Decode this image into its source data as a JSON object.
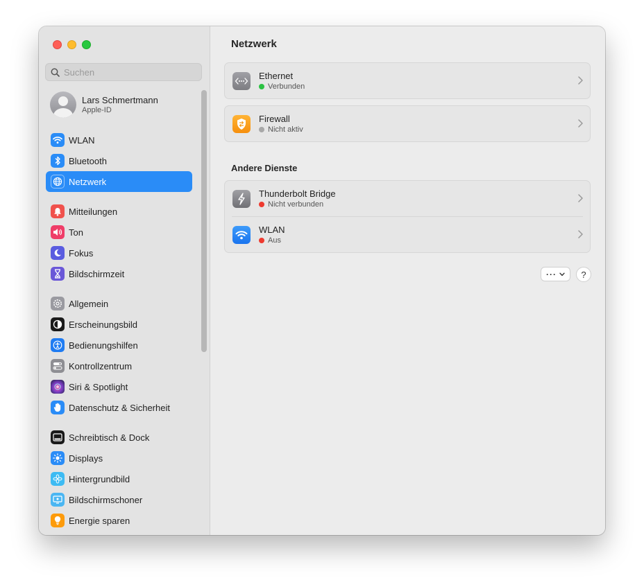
{
  "window": {
    "traffic_lights": [
      "close",
      "minimize",
      "zoom"
    ]
  },
  "sidebar": {
    "search": {
      "placeholder": "Suchen"
    },
    "profile": {
      "name": "Lars Schmertmann",
      "subtitle": "Apple-ID"
    },
    "items": [
      {
        "label": "WLAN",
        "icon": "wifi-icon",
        "color": "#2a8cf7",
        "active": false
      },
      {
        "label": "Bluetooth",
        "icon": "bluetooth-icon",
        "color": "#2a8cf7",
        "active": false
      },
      {
        "label": "Netzwerk",
        "icon": "globe-icon",
        "color": "#2a8cf7",
        "active": true
      },
      {
        "label": "Mitteilungen",
        "icon": "bell-icon",
        "color": "#f0514c",
        "active": false
      },
      {
        "label": "Ton",
        "icon": "speaker-icon",
        "color": "#ef3d68",
        "active": false
      },
      {
        "label": "Fokus",
        "icon": "moon-icon",
        "color": "#5a5ce0",
        "active": false
      },
      {
        "label": "Bildschirmzeit",
        "icon": "hourglass-icon",
        "color": "#6a57d8",
        "active": false
      },
      {
        "label": "Allgemein",
        "icon": "gear-icon",
        "color": "#9a9aa0",
        "active": false
      },
      {
        "label": "Erscheinungsbild",
        "icon": "appearance-icon",
        "color": "#1a1a1a",
        "active": false
      },
      {
        "label": "Bedienungshilfen",
        "icon": "accessibility-icon",
        "color": "#1f7cf2",
        "active": false
      },
      {
        "label": "Kontrollzentrum",
        "icon": "switches-icon",
        "color": "#8e8e93",
        "active": false
      },
      {
        "label": "Siri & Spotlight",
        "icon": "siri-icon",
        "color": "#7b3fc6",
        "active": false
      },
      {
        "label": "Datenschutz & Sicherheit",
        "icon": "hand-icon",
        "color": "#2a8cf7",
        "active": false
      },
      {
        "label": "Schreibtisch & Dock",
        "icon": "dock-icon",
        "color": "#1a1a1a",
        "active": false
      },
      {
        "label": "Displays",
        "icon": "sun-icon",
        "color": "#2a8cf7",
        "active": false
      },
      {
        "label": "Hintergrundbild",
        "icon": "flower-icon",
        "color": "#3dbbf3",
        "active": false
      },
      {
        "label": "Bildschirmschoner",
        "icon": "screensaver-icon",
        "color": "#4ab6f2",
        "active": false
      },
      {
        "label": "Energie sparen",
        "icon": "bulb-icon",
        "color": "#fd9b0b",
        "active": false
      }
    ]
  },
  "main": {
    "title": "Netzwerk",
    "services": [
      {
        "name": "Ethernet",
        "status": "Verbunden",
        "status_color": "#2cc243",
        "icon": "ethernet-icon"
      },
      {
        "name": "Firewall",
        "status": "Nicht aktiv",
        "status_color": "#a8a8a8",
        "icon": "firewall-icon"
      }
    ],
    "other_title": "Andere Dienste",
    "other_services": [
      {
        "name": "Thunderbolt Bridge",
        "status": "Nicht verbunden",
        "status_color": "#ee3a2f",
        "icon": "thunderbolt-icon"
      },
      {
        "name": "WLAN",
        "status": "Aus",
        "status_color": "#ee3a2f",
        "icon": "wifi-icon"
      }
    ],
    "more_button_label": "···",
    "help_button_label": "?"
  }
}
